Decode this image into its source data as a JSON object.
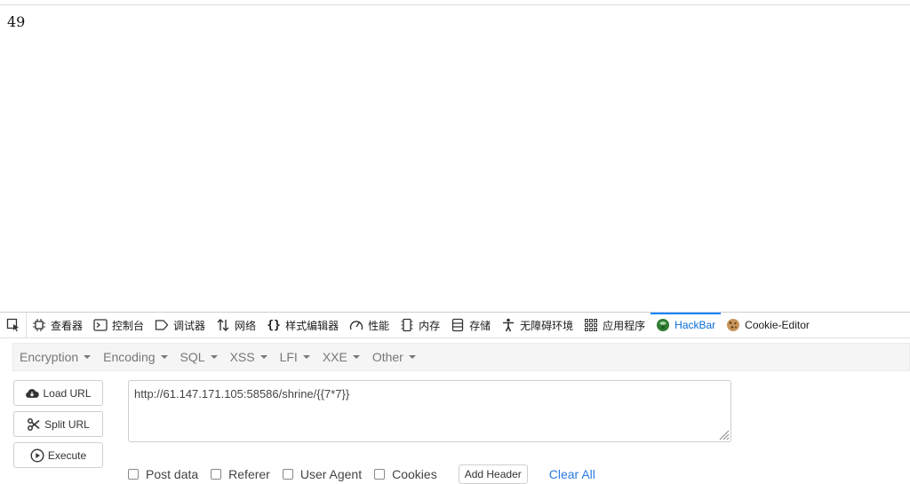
{
  "page": {
    "output_text": "49"
  },
  "devtools": {
    "tabs": [
      {
        "label": "查看器",
        "icon": "inspector-icon"
      },
      {
        "label": "控制台",
        "icon": "console-icon"
      },
      {
        "label": "调试器",
        "icon": "debugger-icon"
      },
      {
        "label": "网络",
        "icon": "network-icon"
      },
      {
        "label": "样式编辑器",
        "icon": "style-editor-icon"
      },
      {
        "label": "性能",
        "icon": "performance-icon"
      },
      {
        "label": "内存",
        "icon": "memory-icon"
      },
      {
        "label": "存储",
        "icon": "storage-icon"
      },
      {
        "label": "无障碍环境",
        "icon": "accessibility-icon"
      },
      {
        "label": "应用程序",
        "icon": "application-icon"
      },
      {
        "label": "HackBar",
        "icon": "hackbar-icon"
      },
      {
        "label": "Cookie-Editor",
        "icon": "cookie-icon"
      }
    ],
    "active_tab": "HackBar",
    "accent_color": "#0a84ff"
  },
  "hackbar": {
    "menu": [
      "Encryption",
      "Encoding",
      "SQL",
      "XSS",
      "LFI",
      "XXE",
      "Other"
    ],
    "buttons": {
      "load_url": "Load URL",
      "split_url": "Split URL",
      "execute": "Execute"
    },
    "url_value": "http://61.147.171.105:58586/shrine/{{7*7}}",
    "options": {
      "post_data": "Post data",
      "referer": "Referer",
      "user_agent": "User Agent",
      "cookies": "Cookies"
    },
    "add_header": "Add Header",
    "clear_all": "Clear All"
  }
}
